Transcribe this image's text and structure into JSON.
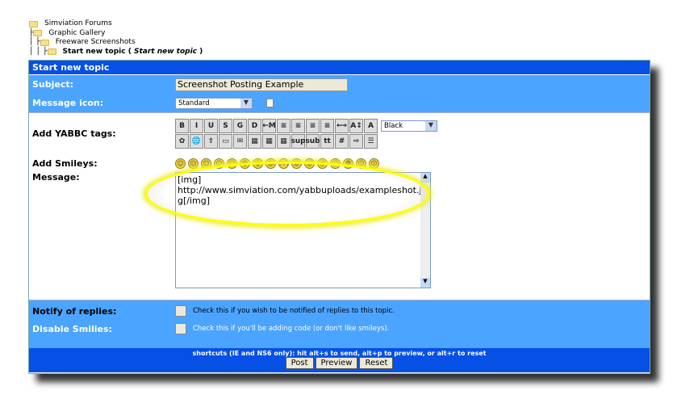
{
  "breadcrumb": {
    "items": [
      "Simviation Forums",
      "Graphic Gallery",
      "Freeware Screenshots"
    ],
    "current": "Start new topic",
    "current_sub": "Start new topic",
    "connectors": [
      "├",
      "│ ├",
      "│ │ ├"
    ]
  },
  "form": {
    "title": "Start new topic",
    "subject_label": "Subject:",
    "subject_value": "Screenshot Posting Example",
    "icon_label": "Message icon:",
    "icon_value": "Standard",
    "tags_label": "Add YABBC tags:",
    "color_value": "Black",
    "tags_row1": [
      "B",
      "I",
      "U",
      "S",
      "G",
      "D",
      "←M",
      "≡",
      "≡",
      "≡",
      "≡",
      "⟷",
      "A↕",
      "A"
    ],
    "tags_row2": [
      "✿",
      "🌐",
      "⇪",
      "▭",
      "✉",
      "▦",
      "▦",
      "▦",
      "sup",
      "sub",
      "tt",
      "#",
      "⇨",
      "☰"
    ],
    "smileys_label": "Add Smileys:",
    "smileys": [
      "☺",
      "☺",
      "☺",
      "☺",
      "☺",
      "☻",
      "☺",
      "☺",
      "???",
      "☺",
      "☺",
      "☺",
      "☺",
      "☻",
      "☺",
      "☹"
    ],
    "message_label": "Message:",
    "message_value": "[img]\nhttp://www.simviation.com/yabbuploads/exampleshot.jpg[/img]",
    "notify_label": "Notify of replies:",
    "notify_hint": "Check this if you wish to be notified of replies to this topic.",
    "disable_label": "Disable Smilies:",
    "disable_hint": "Check this if you'll be adding code (or don't like smileys).",
    "shortcuts": "shortcuts (IE and NS6 only): hit alt+s to send, alt+p to preview, or alt+r to reset",
    "post": "Post",
    "preview": "Preview",
    "reset": "Reset"
  },
  "colors": {
    "header": "#0650e6",
    "rows": "#4ba4ff",
    "highlight": "#ffff00"
  }
}
